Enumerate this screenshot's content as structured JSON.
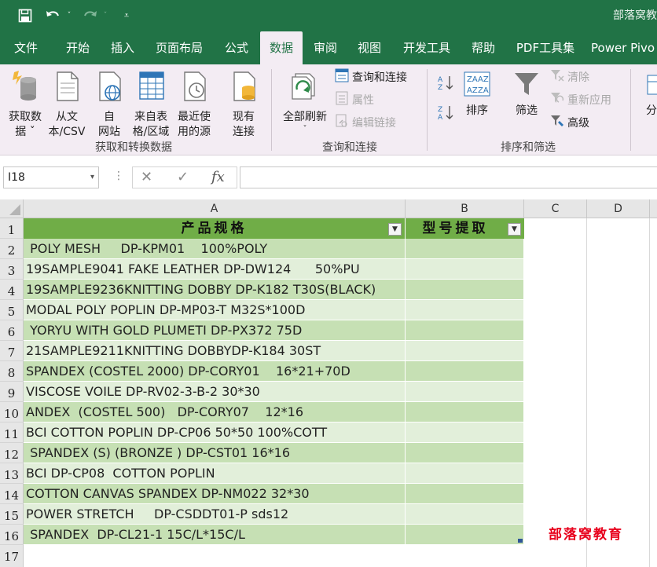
{
  "titlebar": {
    "title": "部落窝教"
  },
  "tabs": [
    {
      "label": "文件"
    },
    {
      "label": "开始"
    },
    {
      "label": "插入"
    },
    {
      "label": "页面布局"
    },
    {
      "label": "公式"
    },
    {
      "label": "数据"
    },
    {
      "label": "审阅"
    },
    {
      "label": "视图"
    },
    {
      "label": "开发工具"
    },
    {
      "label": "帮助"
    },
    {
      "label": "PDF工具集"
    },
    {
      "label": "Power Pivo"
    }
  ],
  "ribbon": {
    "get_data": {
      "line1": "获取数",
      "line2": "据 ˇ"
    },
    "from_text": {
      "line1": "从文",
      "line2": "本/CSV"
    },
    "from_web": {
      "line1": "自",
      "line2": "网站"
    },
    "from_table": {
      "line1": "来自表",
      "line2": "格/区域"
    },
    "recent": {
      "line1": "最近使",
      "line2": "用的源"
    },
    "existing": {
      "line1": "现有",
      "line2": "连接"
    },
    "group1_label": "获取和转换数据",
    "refresh_all": {
      "line1": "全部刷新",
      "line2": "ˇ"
    },
    "queries_connections": "查询和连接",
    "properties": "属性",
    "edit_links": "编辑链接",
    "group2_label": "查询和连接",
    "sort": "排序",
    "filter": "筛选",
    "clear": "清除",
    "reapply": "重新应用",
    "advanced": "高级",
    "group3_label": "排序和筛选",
    "split": "分"
  },
  "formula_bar": {
    "name_box": "I18",
    "fx": "fx",
    "formula": ""
  },
  "columns": [
    "A",
    "B",
    "C",
    "D"
  ],
  "header_row": {
    "row": "1",
    "col_a": "产品规格",
    "col_b": "型号提取"
  },
  "rows": [
    {
      "row": "2",
      "a": " POLY MESH     DP-KPM01    100%POLY",
      "b": ""
    },
    {
      "row": "3",
      "a": "19SAMPLE9041 FAKE LEATHER DP-DW124      50%PU",
      "b": ""
    },
    {
      "row": "4",
      "a": "19SAMPLE9236KNITTING DOBBY DP-K182 T30S(BLACK)",
      "b": ""
    },
    {
      "row": "5",
      "a": "MODAL POLY POPLIN DP-MP03-T M32S*100D",
      "b": ""
    },
    {
      "row": "6",
      "a": " YORYU WITH GOLD PLUMETI DP-PX372 75D",
      "b": ""
    },
    {
      "row": "7",
      "a": "21SAMPLE9211KNITTING DOBBYDP-K184 30ST",
      "b": ""
    },
    {
      "row": "8",
      "a": "SPANDEX (COSTEL 2000) DP-CORY01    16*21+70D",
      "b": ""
    },
    {
      "row": "9",
      "a": "VISCOSE VOILE DP-RV02-3-B-2 30*30",
      "b": ""
    },
    {
      "row": "10",
      "a": "ANDEX  (COSTEL 500)   DP-CORY07    12*16",
      "b": ""
    },
    {
      "row": "11",
      "a": "BCI COTTON POPLIN DP-CP06 50*50 100%COTT",
      "b": ""
    },
    {
      "row": "12",
      "a": " SPANDEX (S) (BRONZE ) DP-CST01 16*16",
      "b": ""
    },
    {
      "row": "13",
      "a": "BCI DP-CP08  COTTON POPLIN",
      "b": ""
    },
    {
      "row": "14",
      "a": "COTTON CANVAS SPANDEX DP-NM022 32*30",
      "b": ""
    },
    {
      "row": "15",
      "a": "POWER STRETCH     DP-CSDDT01-P sds12",
      "b": ""
    },
    {
      "row": "16",
      "a": " SPANDEX  DP-CL21-1 15C/L*15C/L",
      "b": ""
    }
  ],
  "extra_row": "17",
  "watermark": "部落窝教育",
  "colors": {
    "excel_green": "#217346",
    "table_header": "#70ad47",
    "band_dark": "#c6e0b4",
    "band_light": "#e2efda",
    "watermark": "#e8001c"
  }
}
